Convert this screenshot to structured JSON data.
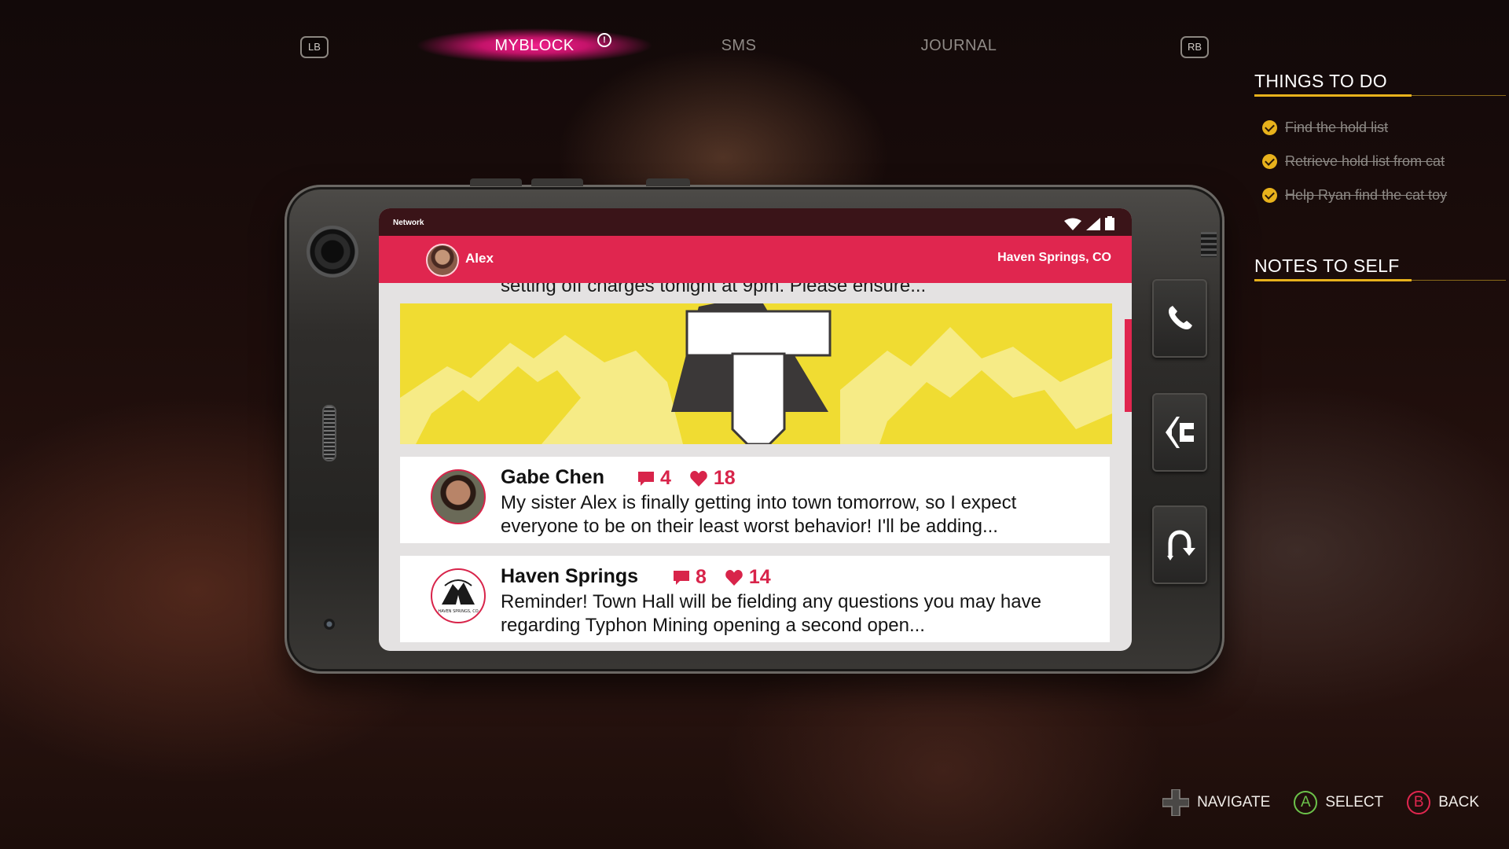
{
  "top_nav": {
    "left_bumper": "LB",
    "right_bumper": "RB",
    "tabs": [
      {
        "label": "MYBLOCK",
        "active": true,
        "alert": "!"
      },
      {
        "label": "SMS",
        "active": false
      },
      {
        "label": "JOURNAL",
        "active": false
      }
    ]
  },
  "right_panel": {
    "things_heading": "THINGS TO DO",
    "tasks": [
      {
        "label": "Find the hold list",
        "done": true
      },
      {
        "label": "Retrieve hold list from cat",
        "done": true
      },
      {
        "label": "Help Ryan find the cat toy",
        "done": true
      }
    ],
    "notes_heading": "NOTES TO SELF"
  },
  "phone": {
    "status_label": "Network",
    "user_name": "Alex",
    "location": "Haven Springs, CO",
    "cut_off_text": "setting off charges tonight at 9pm. Please ensure...",
    "posts": [
      {
        "author": "Gabe Chen",
        "comments": "4",
        "likes": "18",
        "body": "My sister Alex is finally getting into town tomorrow, so I expect everyone to be on their least worst behavior! I'll be adding..."
      },
      {
        "author": "Haven Springs",
        "comments": "8",
        "likes": "14",
        "body": "Reminder! Town Hall will be fielding any questions you may have regarding Typhon Mining opening a second open...",
        "avatar_text": "HAVEN SPRINGS, CO"
      }
    ]
  },
  "prompts": [
    {
      "label": "NAVIGATE",
      "icon": "dpad-icon"
    },
    {
      "label": "SELECT",
      "button": "A",
      "color": "#6cc24a"
    },
    {
      "label": "BACK",
      "button": "B",
      "color": "#e0264f"
    }
  ],
  "colors": {
    "accent": "#e0264f",
    "task_check": "#e8b21c",
    "banner_yellow": "#f0dc32"
  }
}
